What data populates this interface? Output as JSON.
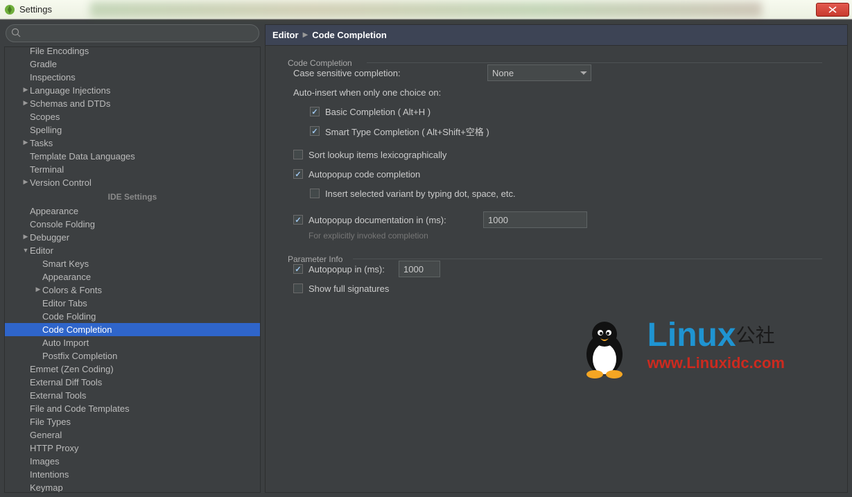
{
  "window": {
    "title": "Settings"
  },
  "breadcrumb": {
    "root": "Editor",
    "leaf": "Code Completion"
  },
  "search": {
    "placeholder": ""
  },
  "idesettings_label": "IDE Settings",
  "tree": [
    {
      "label": "File Encodings",
      "indent": 1,
      "arrow": "none",
      "vis": false
    },
    {
      "label": "Gradle",
      "indent": 1,
      "arrow": "none"
    },
    {
      "label": "Inspections",
      "indent": 1,
      "arrow": "none"
    },
    {
      "label": "Language Injections",
      "indent": 1,
      "arrow": "col"
    },
    {
      "label": "Schemas and DTDs",
      "indent": 1,
      "arrow": "col"
    },
    {
      "label": "Scopes",
      "indent": 1,
      "arrow": "none"
    },
    {
      "label": "Spelling",
      "indent": 1,
      "arrow": "none"
    },
    {
      "label": "Tasks",
      "indent": 1,
      "arrow": "col"
    },
    {
      "label": "Template Data Languages",
      "indent": 1,
      "arrow": "none"
    },
    {
      "label": "Terminal",
      "indent": 1,
      "arrow": "none"
    },
    {
      "label": "Version Control",
      "indent": 1,
      "arrow": "col"
    },
    {
      "header": true
    },
    {
      "label": "Appearance",
      "indent": 1,
      "arrow": "none"
    },
    {
      "label": "Console Folding",
      "indent": 1,
      "arrow": "none"
    },
    {
      "label": "Debugger",
      "indent": 1,
      "arrow": "col"
    },
    {
      "label": "Editor",
      "indent": 1,
      "arrow": "exp"
    },
    {
      "label": "Smart Keys",
      "indent": 2,
      "arrow": "none"
    },
    {
      "label": "Appearance",
      "indent": 2,
      "arrow": "none"
    },
    {
      "label": "Colors & Fonts",
      "indent": 2,
      "arrow": "col"
    },
    {
      "label": "Editor Tabs",
      "indent": 2,
      "arrow": "none"
    },
    {
      "label": "Code Folding",
      "indent": 2,
      "arrow": "none"
    },
    {
      "label": "Code Completion",
      "indent": 2,
      "arrow": "none",
      "selected": true
    },
    {
      "label": "Auto Import",
      "indent": 2,
      "arrow": "none"
    },
    {
      "label": "Postfix Completion",
      "indent": 2,
      "arrow": "none"
    },
    {
      "label": "Emmet (Zen Coding)",
      "indent": 1,
      "arrow": "none"
    },
    {
      "label": "External Diff Tools",
      "indent": 1,
      "arrow": "none"
    },
    {
      "label": "External Tools",
      "indent": 1,
      "arrow": "none"
    },
    {
      "label": "File and Code Templates",
      "indent": 1,
      "arrow": "none"
    },
    {
      "label": "File Types",
      "indent": 1,
      "arrow": "none"
    },
    {
      "label": "General",
      "indent": 1,
      "arrow": "none"
    },
    {
      "label": "HTTP Proxy",
      "indent": 1,
      "arrow": "none"
    },
    {
      "label": "Images",
      "indent": 1,
      "arrow": "none"
    },
    {
      "label": "Intentions",
      "indent": 1,
      "arrow": "none"
    },
    {
      "label": "Keymap",
      "indent": 1,
      "arrow": "none"
    }
  ],
  "section1": {
    "title": "Code Completion",
    "case_label": "Case sensitive completion:",
    "case_value": "None",
    "autoinsert_label": "Auto-insert when only one choice on:",
    "basic": {
      "checked": true,
      "label": "Basic Completion ( Alt+H )"
    },
    "smart": {
      "checked": true,
      "label": "Smart Type Completion ( Alt+Shift+空格 )"
    },
    "sort": {
      "checked": false,
      "label": "Sort lookup items lexicographically"
    },
    "autopop": {
      "checked": true,
      "label": "Autopopup code completion"
    },
    "insertsel": {
      "checked": false,
      "label": "Insert selected variant by typing dot, space, etc."
    },
    "autodoc": {
      "checked": true,
      "label": "Autopopup documentation in (ms):",
      "value": "1000"
    },
    "autodoc_hint": "For explicitly invoked completion"
  },
  "section2": {
    "title": "Parameter Info",
    "autopop": {
      "checked": true,
      "label": "Autopopup in (ms):",
      "value": "1000"
    },
    "full": {
      "checked": false,
      "label": "Show full signatures"
    }
  },
  "watermark": {
    "line1a": "Linux",
    "line1b": "公社",
    "line2": "www.Linuxidc.com"
  }
}
